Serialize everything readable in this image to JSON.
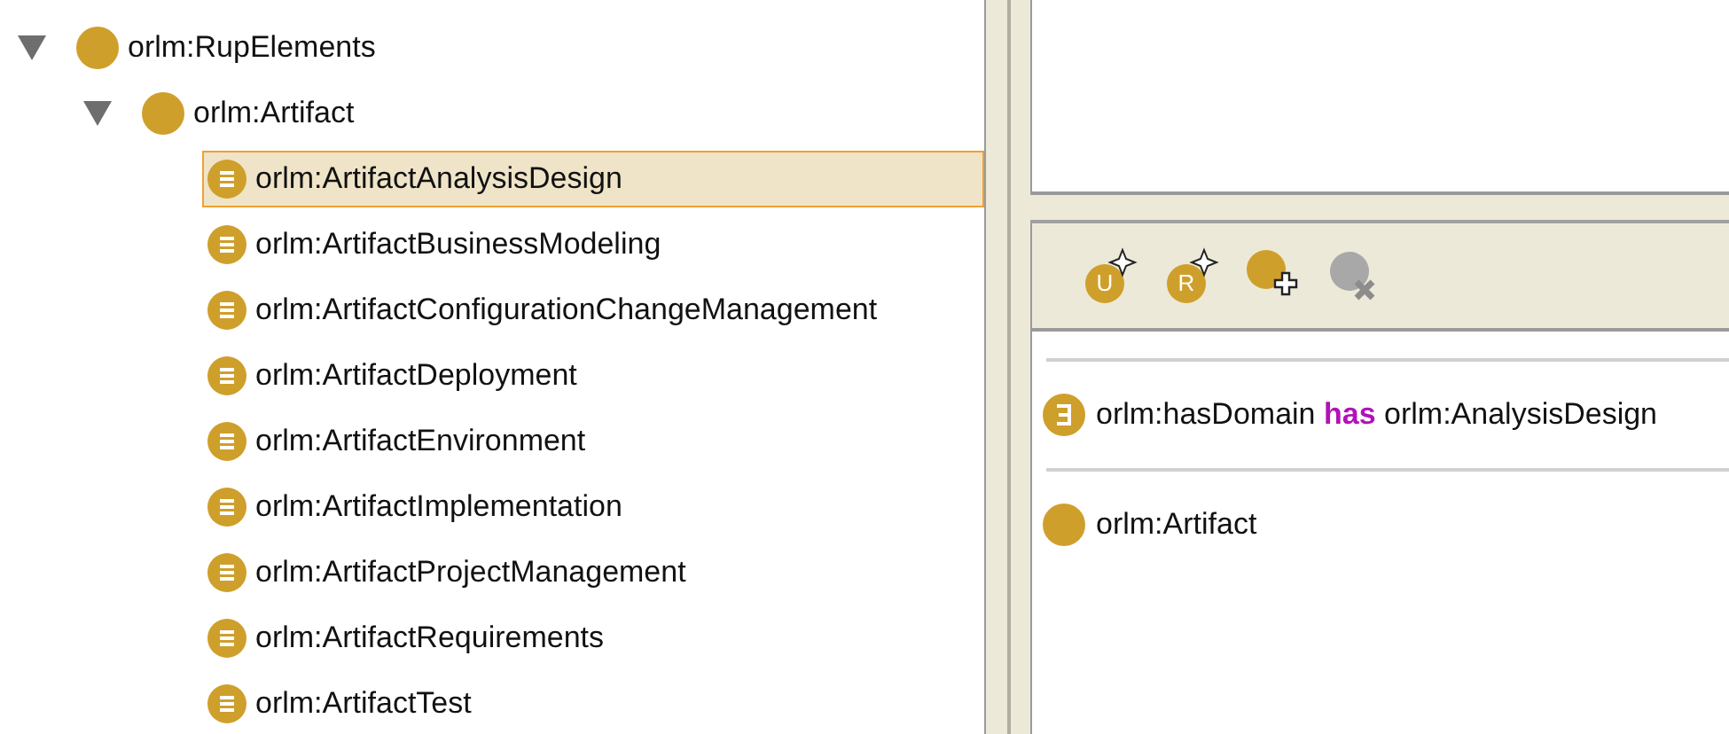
{
  "class_tree": [
    {
      "label": "orlm:RupElements",
      "kind": "class",
      "expanded": true,
      "selected": false,
      "children": [
        {
          "label": "orlm:Artifact",
          "kind": "class",
          "expanded": true,
          "selected": false,
          "children": [
            {
              "label": "orlm:ArtifactAnalysisDesign",
              "kind": "defined-class",
              "selected": true
            },
            {
              "label": "orlm:ArtifactBusinessModeling",
              "kind": "defined-class",
              "selected": false
            },
            {
              "label": "orlm:ArtifactConfigurationChangeManagement",
              "kind": "defined-class",
              "selected": false
            },
            {
              "label": "orlm:ArtifactDeployment",
              "kind": "defined-class",
              "selected": false
            },
            {
              "label": "orlm:ArtifactEnvironment",
              "kind": "defined-class",
              "selected": false
            },
            {
              "label": "orlm:ArtifactImplementation",
              "kind": "defined-class",
              "selected": false
            },
            {
              "label": "orlm:ArtifactProjectManagement",
              "kind": "defined-class",
              "selected": false
            },
            {
              "label": "orlm:ArtifactRequirements",
              "kind": "defined-class",
              "selected": false
            },
            {
              "label": "orlm:ArtifactTest",
              "kind": "defined-class",
              "selected": false
            }
          ]
        }
      ]
    }
  ],
  "toolbar": [
    {
      "kind": "create",
      "letter": "U",
      "disabled": false
    },
    {
      "kind": "create",
      "letter": "R",
      "disabled": false
    },
    {
      "kind": "add",
      "disabled": false
    },
    {
      "kind": "delete",
      "disabled": true
    }
  ],
  "conditions": [
    {
      "kind": "restriction",
      "text": "orlm:hasDomain **has** orlm:AnalysisDesign"
    },
    {
      "kind": "class",
      "text": "orlm:Artifact"
    }
  ]
}
